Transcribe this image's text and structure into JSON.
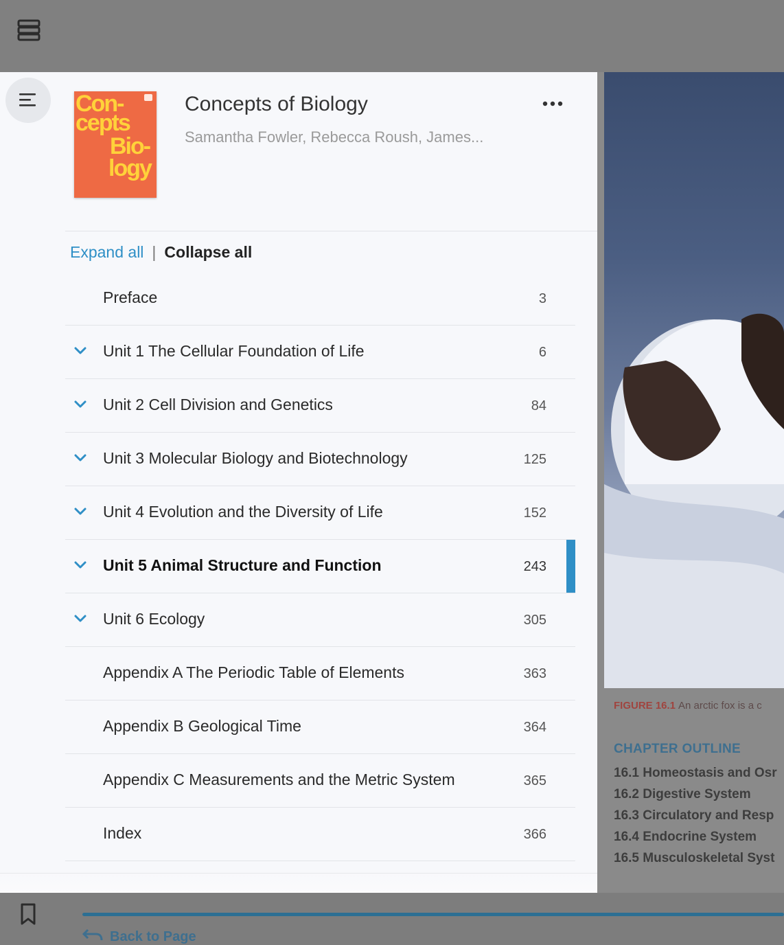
{
  "colors": {
    "accent": "#2f8fc6",
    "cover_bg": "#ee6a44",
    "cover_text": "#ffd23a",
    "panel_bg": "#f7f8fb"
  },
  "icons": {
    "library": "library-stack-icon",
    "menu": "menu-lines-icon",
    "more": "more-dots-icon",
    "chevron": "chevron-down-icon",
    "bookmark": "bookmark-icon",
    "back": "back-arrow-icon"
  },
  "book": {
    "title": "Concepts of Biology",
    "authors": "Samantha Fowler, Rebecca Roush, James...",
    "cover_text": [
      "Con-",
      "cepts",
      "Bio-",
      "logy"
    ]
  },
  "toc_controls": {
    "expand_all": "Expand all",
    "separator": "|",
    "collapse_all": "Collapse all"
  },
  "toc": [
    {
      "label": "Preface",
      "page": "3",
      "expandable": false,
      "active": false
    },
    {
      "label": "Unit 1 The Cellular Foundation of Life",
      "page": "6",
      "expandable": true,
      "active": false
    },
    {
      "label": "Unit 2 Cell Division and Genetics",
      "page": "84",
      "expandable": true,
      "active": false
    },
    {
      "label": "Unit 3 Molecular Biology and Biotechnology",
      "page": "125",
      "expandable": true,
      "active": false
    },
    {
      "label": "Unit 4 Evolution and the Diversity of Life",
      "page": "152",
      "expandable": true,
      "active": false
    },
    {
      "label": "Unit 5 Animal Structure and Function",
      "page": "243",
      "expandable": true,
      "active": true
    },
    {
      "label": "Unit 6 Ecology",
      "page": "305",
      "expandable": true,
      "active": false
    },
    {
      "label": "Appendix A The Periodic Table of Elements",
      "page": "363",
      "expandable": false,
      "active": false
    },
    {
      "label": "Appendix B Geological Time",
      "page": "364",
      "expandable": false,
      "active": false
    },
    {
      "label": "Appendix C Measurements and the Metric System",
      "page": "365",
      "expandable": false,
      "active": false
    },
    {
      "label": "Index",
      "page": "366",
      "expandable": false,
      "active": false
    }
  ],
  "page_preview": {
    "figure_number": "FIGURE 16.1",
    "figure_caption": "An arctic fox is a c",
    "chapter_outline_title": "CHAPTER OUTLINE",
    "chapter_outline": [
      "16.1 Homeostasis and Osr",
      "16.2 Digestive System",
      "16.3 Circulatory and Resp",
      "16.4 Endocrine System",
      "16.5 Musculoskeletal Syst"
    ]
  },
  "bottom_bar": {
    "back_to_page": "Back to Page"
  }
}
